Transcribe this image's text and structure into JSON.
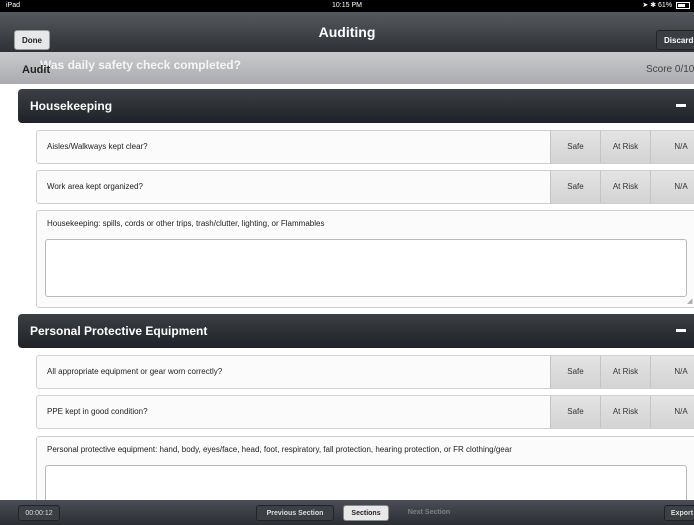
{
  "status_bar": {
    "device": "iPad",
    "time": "10:15 PM",
    "battery": "61%"
  },
  "nav": {
    "title": "Auditing",
    "done_label": "Done",
    "discard_label": "Discard"
  },
  "audit_bar": {
    "label": "Audit",
    "question": "Was daily safety check completed?",
    "score": "Score 0/10"
  },
  "options": {
    "safe": "Safe",
    "at_risk": "At Risk",
    "na": "N/A"
  },
  "sections": [
    {
      "title": "Housekeeping",
      "questions": [
        "Aisles/Walkways kept clear?",
        "Work area kept organized?"
      ],
      "notes_label": "Housekeeping: spills, cords or other trips, trash/clutter, lighting, or Flammables"
    },
    {
      "title": "Personal Protective Equipment",
      "questions": [
        "All appropriate equipment or gear worn correctly?",
        "PPE kept in good condition?"
      ],
      "notes_label": "Personal protective equipment: hand, body, eyes/face, head, foot, respiratory, fall protection, hearing protection, or FR clothing/gear"
    }
  ],
  "toolbar": {
    "timer": "00:00:12",
    "previous": "Previous Section",
    "sections": "Sections",
    "next": "Next Section",
    "export": "Export"
  }
}
